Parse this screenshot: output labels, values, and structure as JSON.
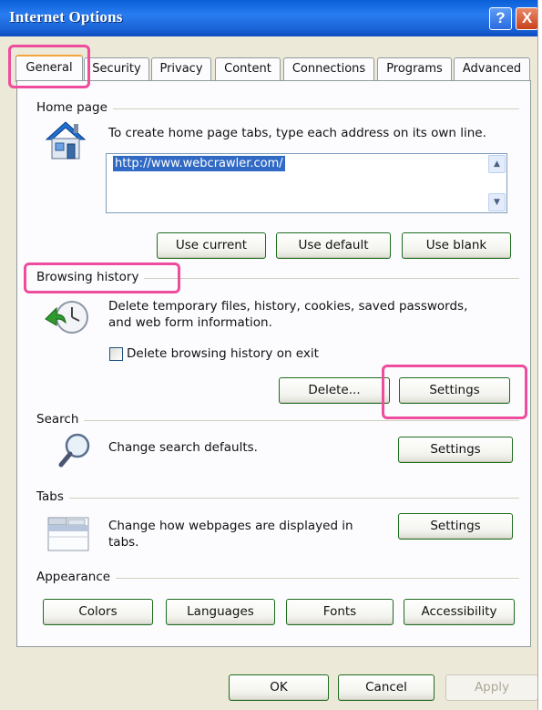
{
  "window": {
    "title": "Internet Options",
    "help_glyph": "?",
    "close_glyph": "X"
  },
  "tabs": [
    "General",
    "Security",
    "Privacy",
    "Content",
    "Connections",
    "Programs",
    "Advanced"
  ],
  "home_page": {
    "label": "Home page",
    "description": "To create home page tabs, type each address on its own line.",
    "address": "http://www.webcrawler.com/",
    "buttons": {
      "use_current": "Use current",
      "use_default": "Use default",
      "use_blank": "Use blank"
    }
  },
  "browsing_history": {
    "label": "Browsing history",
    "description_line1": "Delete temporary files, history, cookies, saved passwords,",
    "description_line2": "and web form information.",
    "checkbox_label": "Delete browsing history on exit",
    "checkbox_checked": false,
    "buttons": {
      "delete": "Delete...",
      "settings": "Settings"
    }
  },
  "search": {
    "label": "Search",
    "description": "Change search defaults.",
    "settings": "Settings"
  },
  "tabs_section": {
    "label": "Tabs",
    "description_line1": "Change how webpages are displayed in",
    "description_line2": "tabs.",
    "settings": "Settings"
  },
  "appearance": {
    "label": "Appearance",
    "buttons": {
      "colors": "Colors",
      "languages": "Languages",
      "fonts": "Fonts",
      "accessibility": "Accessibility"
    }
  },
  "footer": {
    "ok": "OK",
    "cancel": "Cancel",
    "apply": "Apply"
  },
  "colors": {
    "titlebar": "#1a63d6",
    "dialog_bg": "#ECE9D8",
    "highlight": "#ee4c9c",
    "button_border": "#1e6c1e"
  }
}
